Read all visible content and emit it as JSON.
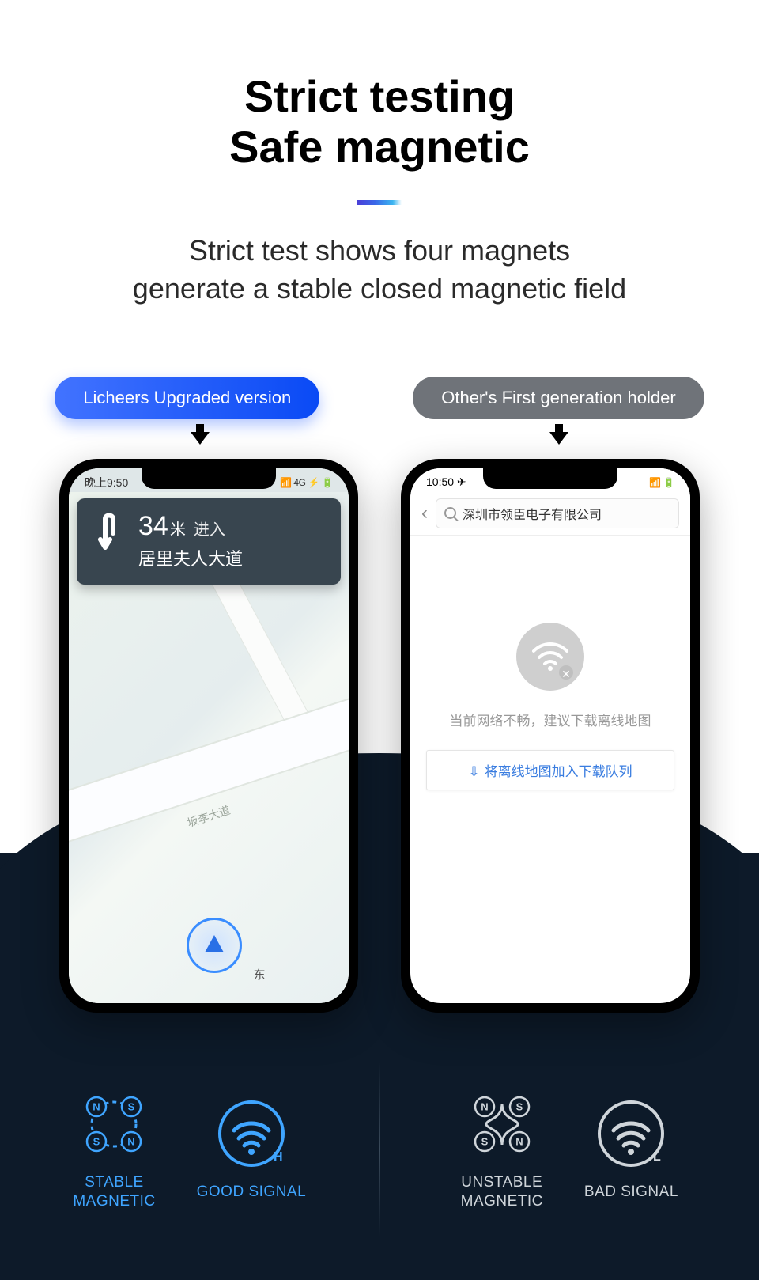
{
  "header": {
    "title_line1": "Strict testing",
    "title_line2": "Safe magnetic",
    "subtitle_line1": "Strict test shows four magnets",
    "subtitle_line2": "generate a stable closed magnetic field"
  },
  "pills": {
    "left": "Licheers Upgraded version",
    "right": "Other's First generation holder"
  },
  "left_phone": {
    "status_time": "晚上9:50",
    "status_right": "📶 4G ⚡ 🔋",
    "nav_distance": "34",
    "nav_unit": "米",
    "nav_enter": "进入",
    "nav_road": "居里夫人大道",
    "road_label": "坂李大道",
    "east_label": "东"
  },
  "right_phone": {
    "status_time": "10:50 ✈",
    "status_right": "📶 🔋",
    "search_text": "深圳市领臣电子有限公司",
    "empty_text": "当前网络不畅，建议下载离线地图",
    "download_icon": "⇩",
    "download_label": "将离线地图加入下载队列"
  },
  "badges": {
    "stable": "STABLE\nMAGNETIC",
    "good": "GOOD SIGNAL",
    "unstable": "UNSTABLE\nMAGNETIC",
    "bad": "BAD SIGNAL",
    "wifi_h": "H",
    "wifi_l": "L",
    "pole_n": "N",
    "pole_s": "S"
  }
}
